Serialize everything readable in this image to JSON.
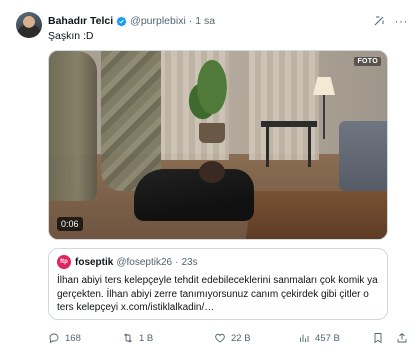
{
  "tweet": {
    "author_name": "Bahadır Telci",
    "handle": "@purplebixi",
    "separator": "·",
    "time": "1 sa",
    "text": "Şaşkın :D",
    "more_label": "···"
  },
  "media": {
    "duration": "0:06",
    "watermark": "FOTO"
  },
  "quote": {
    "avatar_text": "ftp",
    "author_name": "foseptik",
    "handle": "@foseptik26",
    "separator": "·",
    "time": "23s",
    "text": "İlhan abiyi ters kelepçeyle tehdit edebileceklerini sanmaları çok komik ya gerçekten. İlhan abiyi zerre tanımıyorsunuz canım çekirdek gibi çitler o ters kelepçeyi x.com/istiklalkadin/…"
  },
  "actions": {
    "replies": "168",
    "retweets": "1 B",
    "likes": "22 B",
    "views": "457 B"
  },
  "colors": {
    "verified": "#1d9bf0",
    "secondary_text": "#536471",
    "border": "#cfd9de"
  }
}
